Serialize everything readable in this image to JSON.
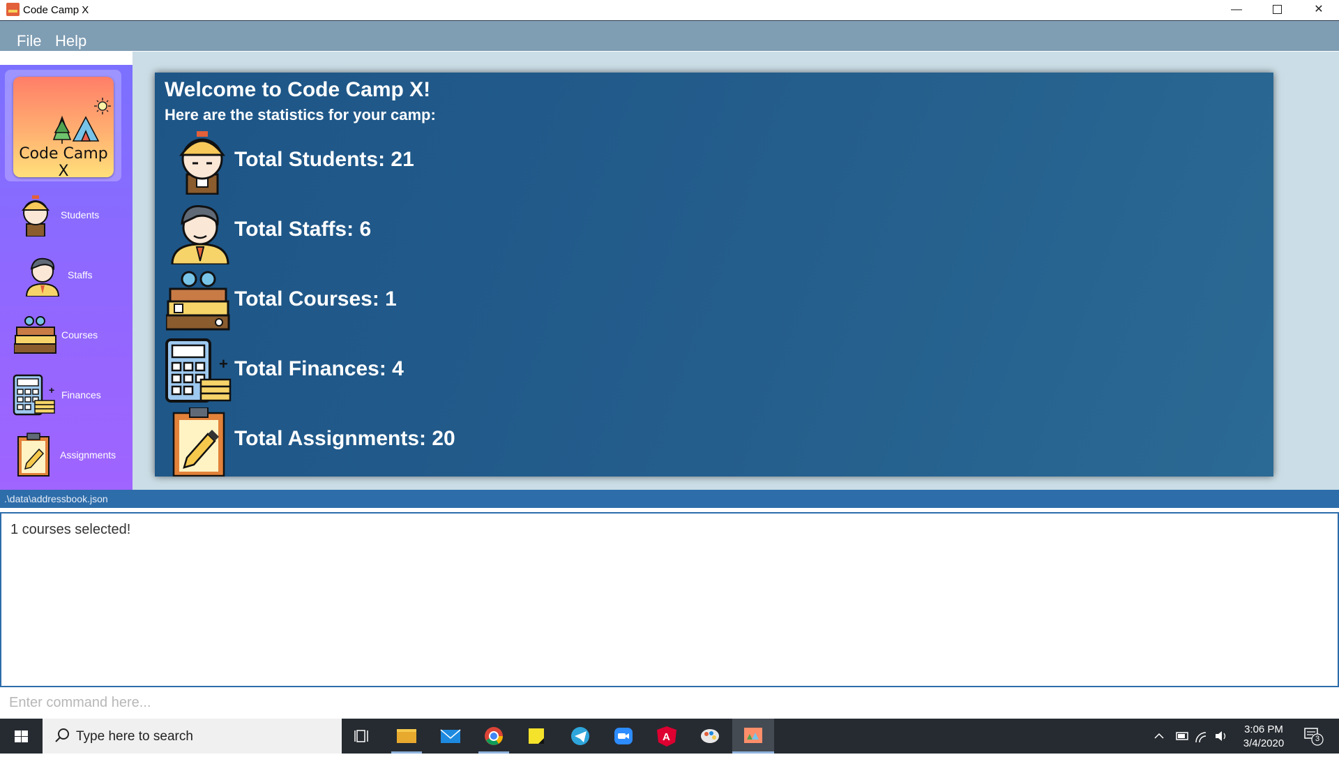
{
  "window": {
    "title": "Code Camp X",
    "min": "—",
    "close": "✕"
  },
  "menu": {
    "file": "File",
    "help": "Help"
  },
  "logo": {
    "text": "Code Camp X"
  },
  "sidebar": {
    "items": [
      {
        "label": "Students"
      },
      {
        "label": "Staffs"
      },
      {
        "label": "Courses"
      },
      {
        "label": "Finances"
      },
      {
        "label": "Assignments"
      }
    ]
  },
  "dashboard": {
    "welcome": "Welcome to Code Camp X!",
    "subtitle": "Here are the statistics for your camp:",
    "stats": [
      {
        "label": "Total Students: 21"
      },
      {
        "label": "Total Staffs: 6"
      },
      {
        "label": "Total Courses: 1"
      },
      {
        "label": "Total Finances: 4"
      },
      {
        "label": "Total Assignments: 20"
      }
    ]
  },
  "status": {
    "file_path": ".\\data\\addressbook.json"
  },
  "output": {
    "message": "1 courses selected!"
  },
  "command": {
    "placeholder": "Enter command here..."
  },
  "taskbar": {
    "search_placeholder": "Type here to search",
    "time": "3:06 PM",
    "date": "3/4/2020",
    "notification_count": "3"
  },
  "colors": {
    "sidebar": "#8f68ff",
    "menubar": "#7f9db3",
    "card": "#1d5587",
    "main_bg": "#cbdde6",
    "path_bar": "#2d6daa"
  }
}
